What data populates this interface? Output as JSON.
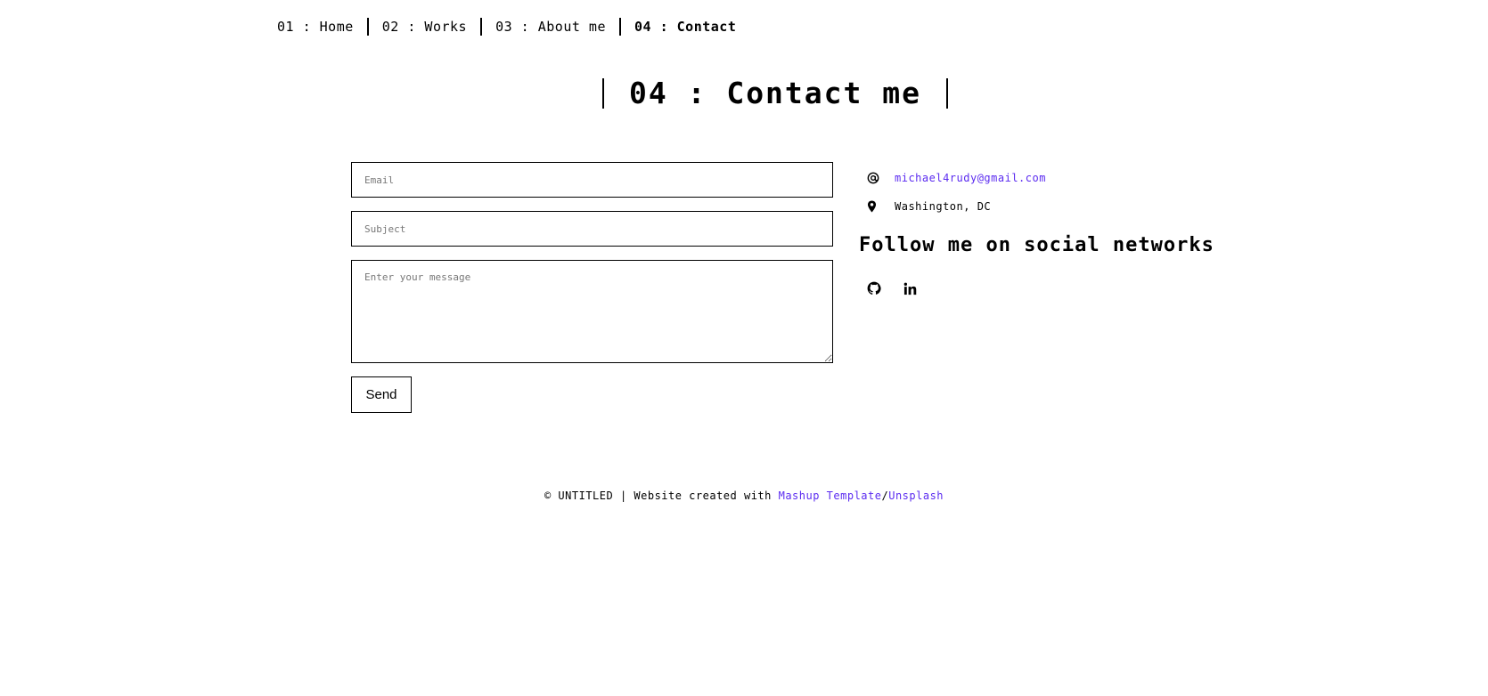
{
  "nav": {
    "items": [
      {
        "label": "01 : Home"
      },
      {
        "label": "02 : Works"
      },
      {
        "label": "03 : About me"
      },
      {
        "label": "04 : Contact"
      }
    ]
  },
  "page": {
    "title": "04 : Contact me"
  },
  "form": {
    "email_placeholder": "Email",
    "subject_placeholder": "Subject",
    "message_placeholder": "Enter your message",
    "send_label": "Send"
  },
  "contact": {
    "email": "michael4rudy@gmail.com",
    "email_icon": "at-icon",
    "location": "Washington, DC",
    "location_icon": "map-pin-icon"
  },
  "social": {
    "heading": "Follow me on social networks",
    "links": [
      {
        "icon": "github-icon"
      },
      {
        "icon": "linkedin-icon"
      }
    ]
  },
  "footer": {
    "prefix": "© UNTITLED | Website created with ",
    "link1": "Mashup Template",
    "separator": "/",
    "link2": "Unsplash"
  },
  "colors": {
    "accent": "#5b2bf0",
    "text": "#000000",
    "background": "#ffffff"
  }
}
